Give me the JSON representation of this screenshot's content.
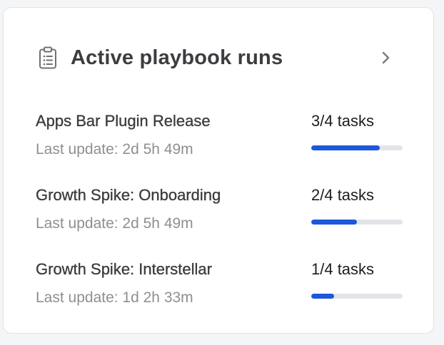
{
  "widget": {
    "title": "Active playbook runs",
    "header_icon": "clipboard-icon",
    "more_icon": "chevron-right-icon"
  },
  "colors": {
    "progress_fill": "#1c58d9",
    "progress_track": "#e3e4e8",
    "title_text": "#3d3c40",
    "muted_text": "#8e8f93"
  },
  "runs": [
    {
      "name": "Apps Bar Plugin Release",
      "last_update": "Last update: 2d 5h 49m",
      "tasks": "3/4 tasks",
      "progress": 0.75
    },
    {
      "name": "Growth Spike: Onboarding",
      "last_update": "Last update: 2d 5h 49m",
      "tasks": "2/4 tasks",
      "progress": 0.5
    },
    {
      "name": "Growth Spike: Interstellar",
      "last_update": "Last update: 1d 2h 33m",
      "tasks": "1/4 tasks",
      "progress": 0.25
    }
  ]
}
